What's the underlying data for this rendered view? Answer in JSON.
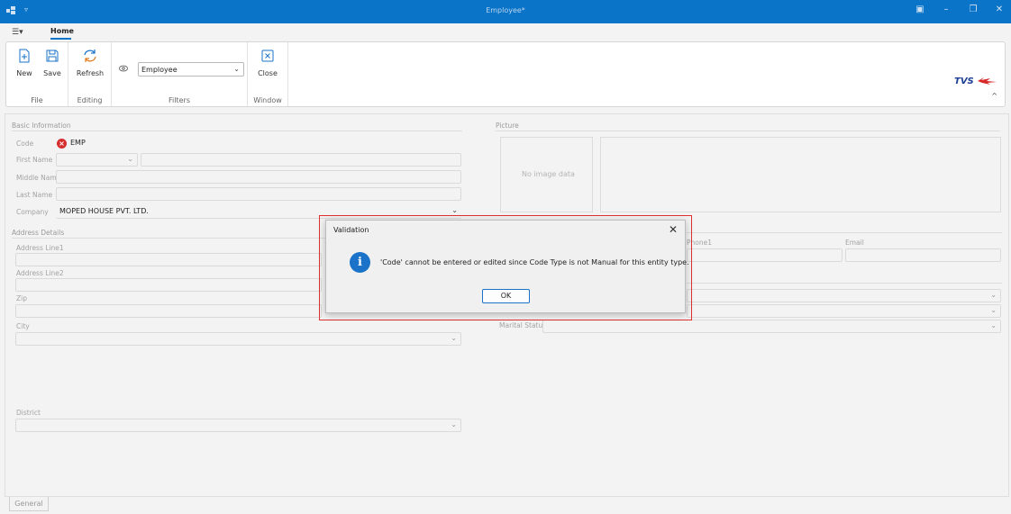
{
  "window": {
    "title": "Employee*"
  },
  "ribbon": {
    "tab_home": "Home",
    "buttons": {
      "new": "New",
      "save": "Save",
      "refresh": "Refresh",
      "close": "Close"
    },
    "groups": {
      "file": "File",
      "editing": "Editing",
      "filters": "Filters",
      "window": "Window"
    },
    "filter_value": "Employee",
    "logo_text": "TVS"
  },
  "form": {
    "basic_info": "Basic Information",
    "labels": {
      "code": "Code",
      "first_name": "First Name",
      "middle_name": "Middle Name",
      "last_name": "Last Name",
      "company": "Company"
    },
    "values": {
      "code": "EMP",
      "company": "MOPED HOUSE PVT. LTD."
    },
    "address_details": "Address Details",
    "address_labels": {
      "line1": "Address Line1",
      "line2": "Address Line2",
      "zip": "Zip",
      "city": "City",
      "district": "District"
    },
    "picture": "Picture",
    "no_image": "No image data",
    "contact_labels": {
      "phone": "Phone1",
      "email": "Email"
    },
    "marital_status": "Marital Status"
  },
  "bottom_tab": "General",
  "dialog": {
    "title": "Validation",
    "message": "'Code' cannot be entered or edited since Code Type is not Manual for this entity type.",
    "ok": "OK"
  }
}
